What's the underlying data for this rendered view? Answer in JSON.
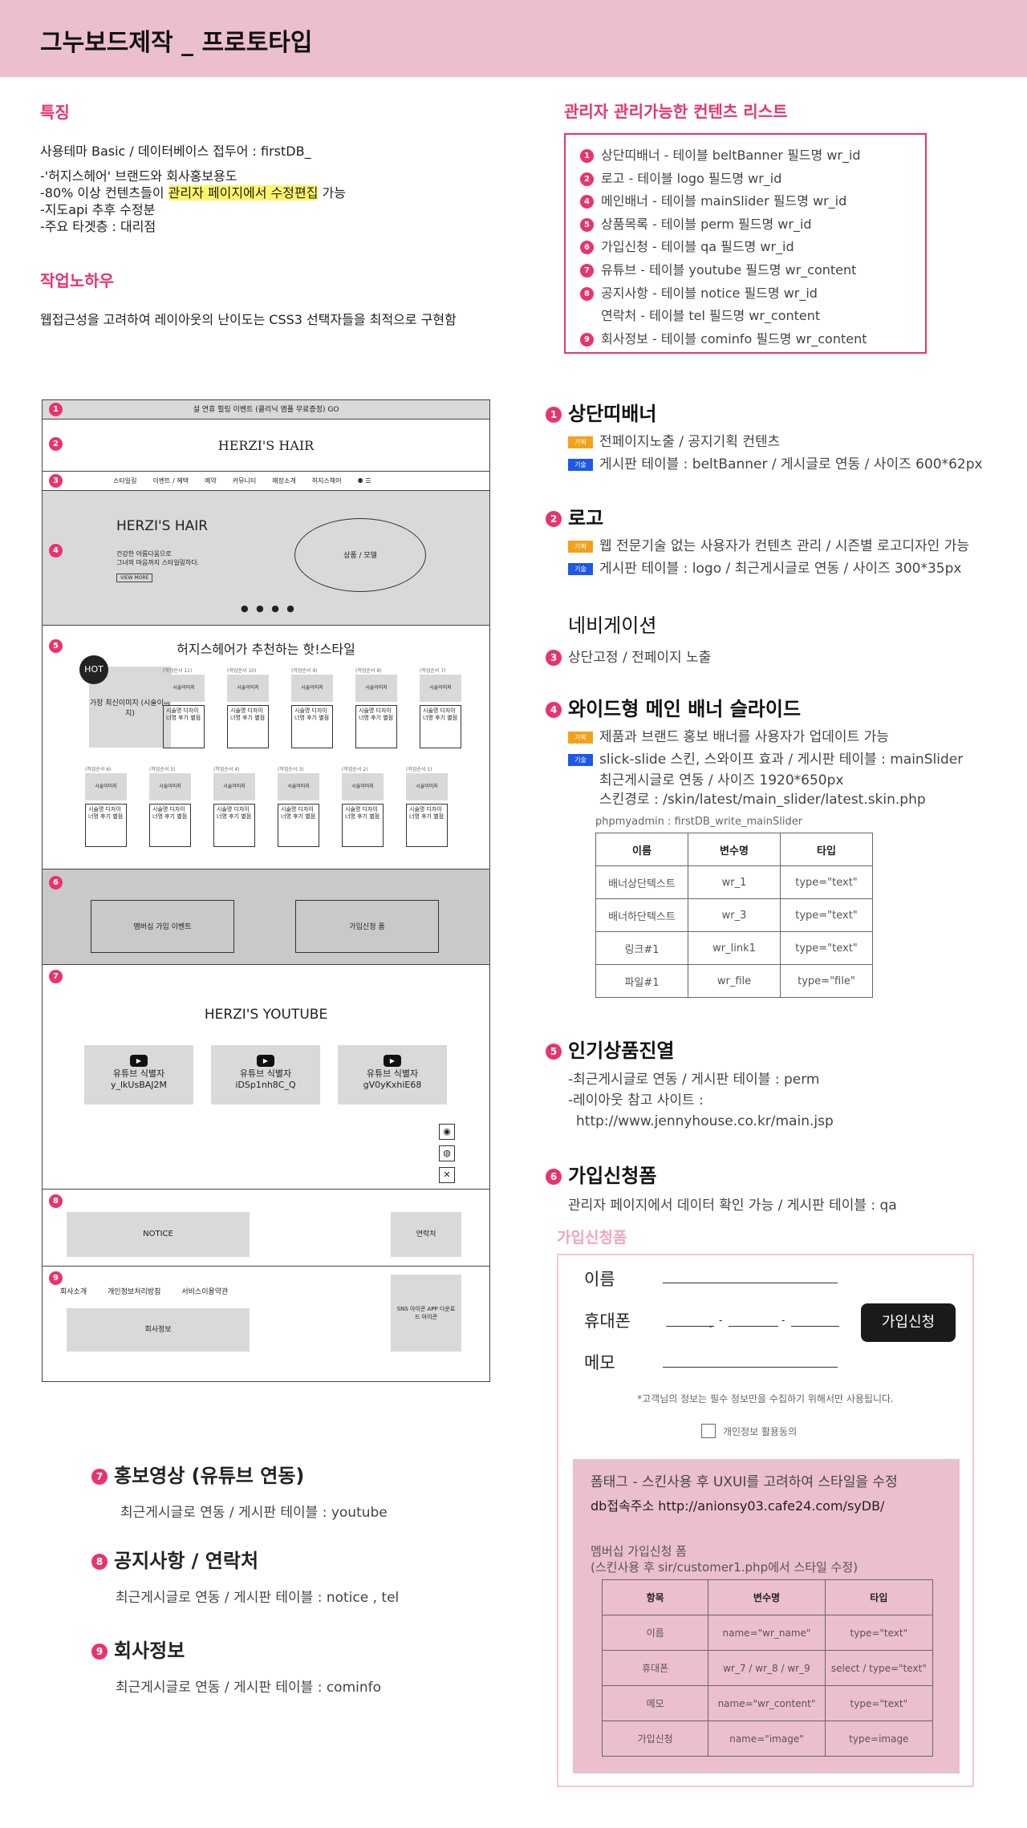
{
  "header": {
    "title": "그누보드제작 _ 프로토타입",
    "bg": "#ebbfcb"
  },
  "features": {
    "heading": "특징",
    "line1": "사용테마 Basic / 데이터베이스 접두어 : firstDB_",
    "line2": "-'허지스헤어' 브랜드와 회사홍보용도",
    "line3_pre": "-80% 이상 컨텐츠들이 ",
    "line3_hl": "관리자 페이지에서 수정편집",
    "line3_post": " 가능",
    "line4": "-지도api 추후 수정분",
    "line5": "-주요 타겟층 : 대리점"
  },
  "knowhow": {
    "heading": "작업노하우",
    "text": "웹접근성을 고려하여 레이아웃의 난이도는 CSS3 선택자들을 최적으로 구현함"
  },
  "admin_list": {
    "heading": "관리자 관리가능한 컨텐츠 리스트",
    "items": [
      {
        "n": "1",
        "text": "상단띠배너 - 테이블 beltBanner 필드명 wr_id"
      },
      {
        "n": "2",
        "text": "로고 - 테이블 logo 필드명 wr_id"
      },
      {
        "n": "4",
        "text": "메인배너 - 테이블 mainSlider 필드명 wr_id"
      },
      {
        "n": "5",
        "text": "상품목록 - 테이블 perm 필드명 wr_id"
      },
      {
        "n": "6",
        "text": "가입신청 - 테이블 qa 필드명 wr_id"
      },
      {
        "n": "7",
        "text": "유튜브 - 테이블 youtube 필드명 wr_content"
      },
      {
        "n": "8",
        "text": "공지사항 - 테이블 notice 필드명 wr_id"
      },
      {
        "n": "",
        "text": "연락처 - 테이블 tel 필드명 wr_content"
      },
      {
        "n": "9",
        "text": "회사정보 - 테이블 cominfo 필드명 wr_content"
      }
    ]
  },
  "wireframe": {
    "belt": "설 연휴 힐링 이벤트 (클리닉 앰플 무료증정) GO",
    "logo": "HERZI'S HAIR",
    "nav": [
      "스타일링",
      "이벤트 / 혜택",
      "예약",
      "커뮤니티",
      "매장소개",
      "허지스헤어"
    ],
    "nav_icons": "⚉ ☰",
    "banner_title": "HERZI'S HAIR",
    "banner_sub1": "건강한 아름다움으로",
    "banner_sub2": "그녀의 마음까지 스타일링하다.",
    "banner_btn": "VIEW MORE",
    "banner_oval": "상품 / 모델",
    "banner_dots": "● ● ● ●",
    "prod_title": "허지스헤어가 추천하는 핫!스타일",
    "hot": "HOT",
    "big_img": "가장 최신이미지 (시술이미지)",
    "prod_caps_row1": [
      "(작업순서 11)",
      "(작업순서 10)",
      "(작업순서 9)",
      "(작업순서 8)",
      "(작업순서 7)"
    ],
    "prod_caps_row2": [
      "(작업순서 6)",
      "(작업순서 5)",
      "(작업순서 4)",
      "(작업순서 3)",
      "(작업순서 2)",
      "(작업순서 1)"
    ],
    "prod_img": "시술이미지",
    "prod_text": "시술명 디자이너명 후기 별점",
    "event_btn": "멤버십 가입 이벤트",
    "apply_btn": "가입신청 폼",
    "yt_title": "HERZI'S YOUTUBE",
    "yt_items": [
      {
        "label": "유튜브 식별자",
        "id": "y_lkUsBAJ2M"
      },
      {
        "label": "유튜브 식별자",
        "id": "iDSp1nh8C_Q"
      },
      {
        "label": "유튜브 식별자",
        "id": "gV0yKxhiE68"
      }
    ],
    "notice": "NOTICE",
    "contact": "연락처",
    "footer_links": [
      "회사소개",
      "개인정보처리방침",
      "서비스이용약관"
    ],
    "company": "회사정보",
    "sns": "SNS 아이콘 APP 다운로드 아이콘"
  },
  "right": {
    "s1": {
      "n": "1",
      "title": "상단띠배너",
      "tag1": "기획",
      "l1": "전페이지노출 / 공지기획 컨텐츠",
      "tag2": "기술",
      "l2": "게시판 테이블 : beltBanner / 게시글로 연동 / 사이즈 600*62px"
    },
    "s2": {
      "n": "2",
      "title": "로고",
      "tag1": "기획",
      "l1": "웹 전문기술 없는 사용자가 컨텐츠 관리 / 시즌별 로고디자인 가능",
      "tag2": "기술",
      "l2": "게시판 테이블 : logo / 최근게시글로 연동 / 사이즈 300*35px"
    },
    "s3": {
      "n": "3",
      "title": "네비게이션",
      "l1": "상단고정 / 전페이지 노출"
    },
    "s4": {
      "n": "4",
      "title": "와이드형 메인 배너 슬라이드",
      "tag1": "기획",
      "l1": "제품과 브랜드 홍보 배너를 사용자가 업데이트 가능",
      "tag2": "기술",
      "l2": "slick-slide 스킨, 스와이프 효과 / 게시판 테이블 : mainSlider",
      "l3": "최근게시글로 연동 / 사이즈 1920*650px",
      "l4": "스킨경로 : /skin/latest/main_slider/latest.skin.php",
      "db": "phpmyadmin : firstDB_write_mainSlider",
      "headers": [
        "이름",
        "변수명",
        "타입"
      ],
      "rows": [
        [
          "배너상단텍스트",
          "wr_1",
          "type=\"text\""
        ],
        [
          "배너하단텍스트",
          "wr_3",
          "type=\"text\""
        ],
        [
          "링크#1",
          "wr_link1",
          "type=\"text\""
        ],
        [
          "파일#1",
          "wr_file",
          "type=\"file\""
        ]
      ]
    },
    "s5": {
      "n": "5",
      "title": "인기상품진열",
      "l1": "-최근게시글로 연동 / 게시판 테이블 : perm",
      "l2": "-레이아웃 참고 사이트 :",
      "l3": "http://www.jennyhouse.co.kr/main.jsp"
    },
    "s6": {
      "n": "6",
      "title": "가입신청폼",
      "l1": "관리자 페이지에서 데이터 확인 가능 / 게시판 테이블 : qa"
    }
  },
  "form": {
    "caption": "가입신청폼",
    "name_label": "이름",
    "phone_label": "휴대폰",
    "memo_label": "메모",
    "submit": "가입신청",
    "notice": "*고객님의 정보는 필수 정보만을 수집하기 위해서만 사용됩니다.",
    "agree": "개인정보 활용동의",
    "tip1": "폼태그 - 스킨사용 후 UXUI를 고려하여 스타일을 수정",
    "tip2": "db접속주소 http://anionsy03.cafe24.com/syDB/",
    "tip3": "멤버십 가입신청 폼",
    "tip4": "(스킨사용 후 sir/customer1.php에서 스타일 수정)",
    "headers": [
      "항목",
      "변수명",
      "타입"
    ],
    "rows": [
      [
        "이름",
        "name=\"wr_name\"",
        "type=\"text\""
      ],
      [
        "휴대폰",
        "wr_7 / wr_8 / wr_9",
        "select / type=\"text\""
      ],
      [
        "메모",
        "name=\"wr_content\"",
        "type=\"text\""
      ],
      [
        "가입신청",
        "name=\"image\"",
        "type=image"
      ]
    ]
  },
  "bottom": {
    "s7": {
      "n": "7",
      "title": "홍보영상 (유튜브 연동)",
      "l1": "최근게시글로 연동 / 게시판 테이블 : youtube"
    },
    "s8": {
      "n": "8",
      "title": "공지사항 / 연락처",
      "l1": "최근게시글로 연동 / 게시판 테이블 : notice , tel"
    },
    "s9": {
      "n": "9",
      "title": "회사정보",
      "l1": "최근게시글로 연동 / 게시판 테이블 : cominfo"
    }
  }
}
